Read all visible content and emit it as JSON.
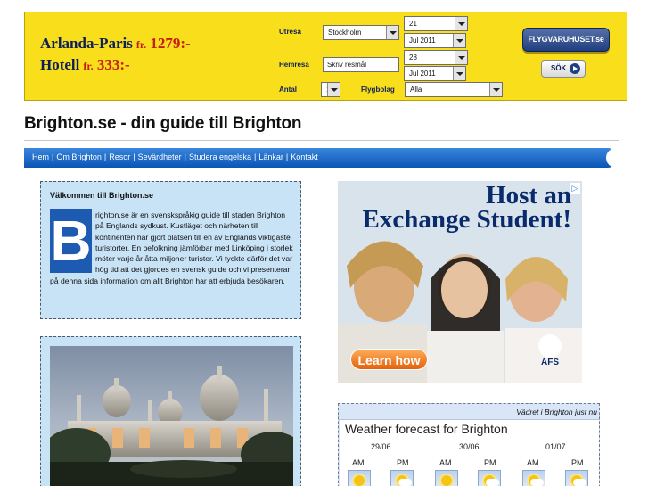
{
  "banner": {
    "route1": "Arlanda-Paris",
    "route1_fr": "fr.",
    "route1_price": "1279:-",
    "route2": "Hotell",
    "route2_fr": "fr.",
    "route2_price": "333:-",
    "utresa_label": "Utresa",
    "from_city": "Stockholm",
    "out_day": "21",
    "out_month": "Jul 2011",
    "hemresa_label": "Hemresa",
    "destination_placeholder": "Skriv resmål",
    "return_day": "28",
    "return_month": "Jul 2011",
    "antal_label": "Antal",
    "passengers": "1",
    "airline_label": "Flygbolag",
    "airline": "Alla",
    "brand": "FLYGVARUHUSET.se",
    "search_label": "SÖK"
  },
  "page": {
    "title": "Brighton.se - din guide till Brighton"
  },
  "nav": {
    "items": [
      "Hem",
      "Om Brighton",
      "Resor",
      "Sevärdheter",
      "Studera engelska",
      "Länkar",
      "Kontakt"
    ],
    "separator": "|"
  },
  "welcome": {
    "heading": "Välkommen till Brighton.se",
    "dropcap": "B",
    "text": "righton.se är en svenskspråkig guide till staden Brighton på Englands sydkust. Kustläget och närheten till kontinenten har gjort platsen till en av Englands viktigaste turistorter. En befolkning jämförbar med Linköping i storlek möter varje år åtta miljoner turister. Vi tyckte därför det var hög tid att det gjordes en svensk guide och vi presenterar på denna sida information om allt Brighton har att erbjuda besökaren."
  },
  "ad": {
    "headline1": "Host an",
    "headline2": "Exchange Student!",
    "cta": "Learn how",
    "logo": "AFS",
    "adchoices": "▷"
  },
  "weather": {
    "header": "Vädret i Brighton just nu",
    "title": "Weather forecast for Brighton",
    "dates": [
      "29/06",
      "30/06",
      "01/07"
    ],
    "periods": [
      "AM",
      "PM",
      "AM",
      "PM",
      "AM",
      "PM"
    ],
    "icons": [
      "sun-icon",
      "cloudy-icon",
      "sun-icon",
      "cloudy-icon",
      "cloudy-icon",
      "cloudy-icon"
    ]
  }
}
